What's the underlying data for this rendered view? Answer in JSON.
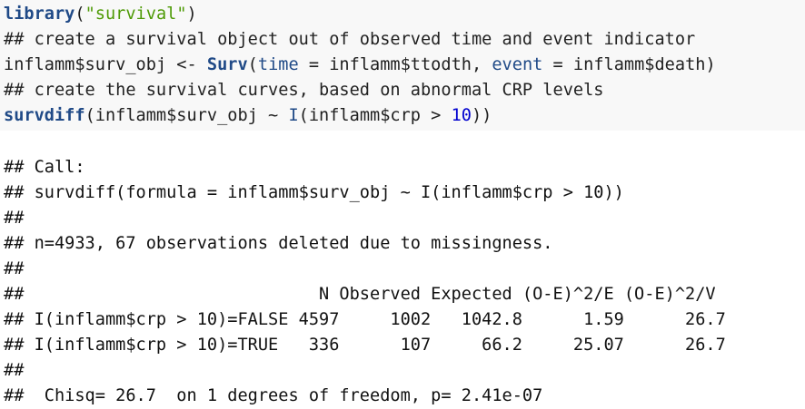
{
  "code": {
    "line1": {
      "fn": "library",
      "open": "(",
      "str": "\"survival\"",
      "close": ")"
    },
    "line2": "## create a survival object out of observed time and event indicator",
    "line3": {
      "pre": "inflamm$surv_obj <- ",
      "fn": "Surv",
      "mid1": "(",
      "arg1": "time",
      "mid2": " = inflamm$ttodth, ",
      "arg2": "event",
      "mid3": " = inflamm$death)"
    },
    "line4": "## create the survival curves, based on abnormal CRP levels",
    "line5": {
      "fn": "survdiff",
      "mid1": "(inflamm$surv_obj ~ ",
      "fn2": "I",
      "mid2": "(inflamm$crp > ",
      "num": "10",
      "close": "))"
    }
  },
  "output": [
    "## Call:",
    "## survdiff(formula = inflamm$surv_obj ~ I(inflamm$crp > 10))",
    "##",
    "## n=4933, 67 observations deleted due to missingness.",
    "##",
    "##                             N Observed Expected (O-E)^2/E (O-E)^2/V",
    "## I(inflamm$crp > 10)=FALSE 4597     1002   1042.8      1.59      26.7",
    "## I(inflamm$crp > 10)=TRUE   336      107     66.2     25.07      26.7",
    "##",
    "##  Chisq= 26.7  on 1 degrees of freedom, p= 2.41e-07"
  ]
}
